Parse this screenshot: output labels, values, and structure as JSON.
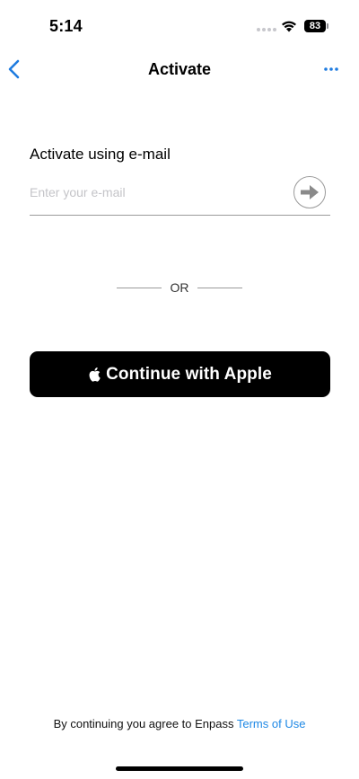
{
  "status_bar": {
    "time": "5:14",
    "battery": "83"
  },
  "nav": {
    "title": "Activate",
    "back_icon": "chevron-left-icon",
    "more_icon": "ellipsis-icon",
    "accent_color": "#1e7be0"
  },
  "email": {
    "label": "Activate using e-mail",
    "placeholder": "Enter your e-mail",
    "value": "",
    "submit_icon": "arrow-right-icon"
  },
  "divider": {
    "text": "OR"
  },
  "apple_button": {
    "label": "Continue with Apple",
    "icon": "apple-logo-icon",
    "background": "#000000"
  },
  "footer": {
    "prefix": "By continuing you agree to Enpass ",
    "link": "Terms of Use",
    "link_color": "#1e88e5"
  }
}
